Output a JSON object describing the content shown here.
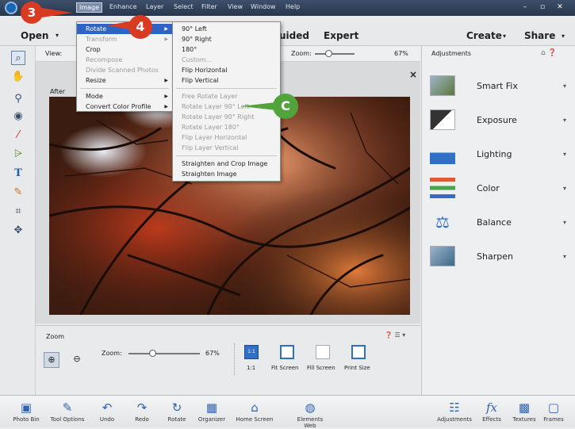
{
  "menubar": {
    "items": [
      "Image",
      "Enhance",
      "Layer",
      "Select",
      "Filter",
      "View",
      "Window",
      "Help"
    ],
    "controls": {
      "minimize": "–",
      "restore": "▫",
      "close": "✕"
    }
  },
  "modebar": {
    "open_label": "Open",
    "guided_label": "uided",
    "expert_label": "Expert",
    "create_label": "Create",
    "share_label": "Share"
  },
  "options": {
    "view_label": "View:",
    "zoom_label": "Zoom:",
    "zoom_value": "67%",
    "zoom_level": 0.33
  },
  "canvas": {
    "after_label": "After",
    "close_glyph": "×"
  },
  "image_menu": {
    "items": [
      {
        "label": "Rotate",
        "submenu": true,
        "highlighted": true
      },
      {
        "label": "Transform",
        "submenu": true,
        "disabled": true
      },
      {
        "label": "Crop"
      },
      {
        "label": "Recompose",
        "disabled": true
      },
      {
        "label": "Divide Scanned Photos",
        "disabled": true
      },
      {
        "label": "Resize",
        "submenu": true
      },
      {
        "label": "Mode",
        "submenu": true
      },
      {
        "label": "Convert Color Profile",
        "submenu": true
      }
    ]
  },
  "rotate_menu": {
    "items": [
      {
        "label": "90° Left"
      },
      {
        "label": "90° Right"
      },
      {
        "label": "180°"
      },
      {
        "label": "Custom...",
        "disabled": true
      },
      {
        "label": "Flip Horizontal"
      },
      {
        "label": "Flip Vertical"
      },
      {
        "label": "Free Rotate Layer",
        "disabled": true
      },
      {
        "label": "Rotate Layer 90° Left",
        "disabled": true
      },
      {
        "label": "Rotate Layer 90° Right",
        "disabled": true
      },
      {
        "label": "Rotate Layer 180°",
        "disabled": true
      },
      {
        "label": "Flip Layer Horizontal",
        "disabled": true
      },
      {
        "label": "Flip Layer Vertical",
        "disabled": true
      },
      {
        "label": "Straighten and Crop Image"
      },
      {
        "label": "Straighten Image"
      }
    ]
  },
  "callouts": {
    "c3": "3",
    "c4": "4",
    "cC": "C"
  },
  "adjustments": {
    "title": "Adjustments",
    "items": [
      "Smart Fix",
      "Exposure",
      "Lighting",
      "Color",
      "Balance",
      "Sharpen"
    ]
  },
  "zoom_panel": {
    "title": "Zoom",
    "zoom_label": "Zoom:",
    "zoom_value": "67%",
    "zoom_level": 0.33,
    "buttons": [
      "1:1",
      "Fit Screen",
      "Fill Screen",
      "Print Size"
    ],
    "one_to_one_glyph": "1:1"
  },
  "bottombar": {
    "left": [
      "Photo Bin",
      "Tool Options",
      "Undo",
      "Redo",
      "Rotate",
      "Organizer",
      "Home Screen",
      "Elements Web"
    ],
    "right": [
      "Adjustments",
      "Effects",
      "Textures",
      "Frames"
    ]
  }
}
